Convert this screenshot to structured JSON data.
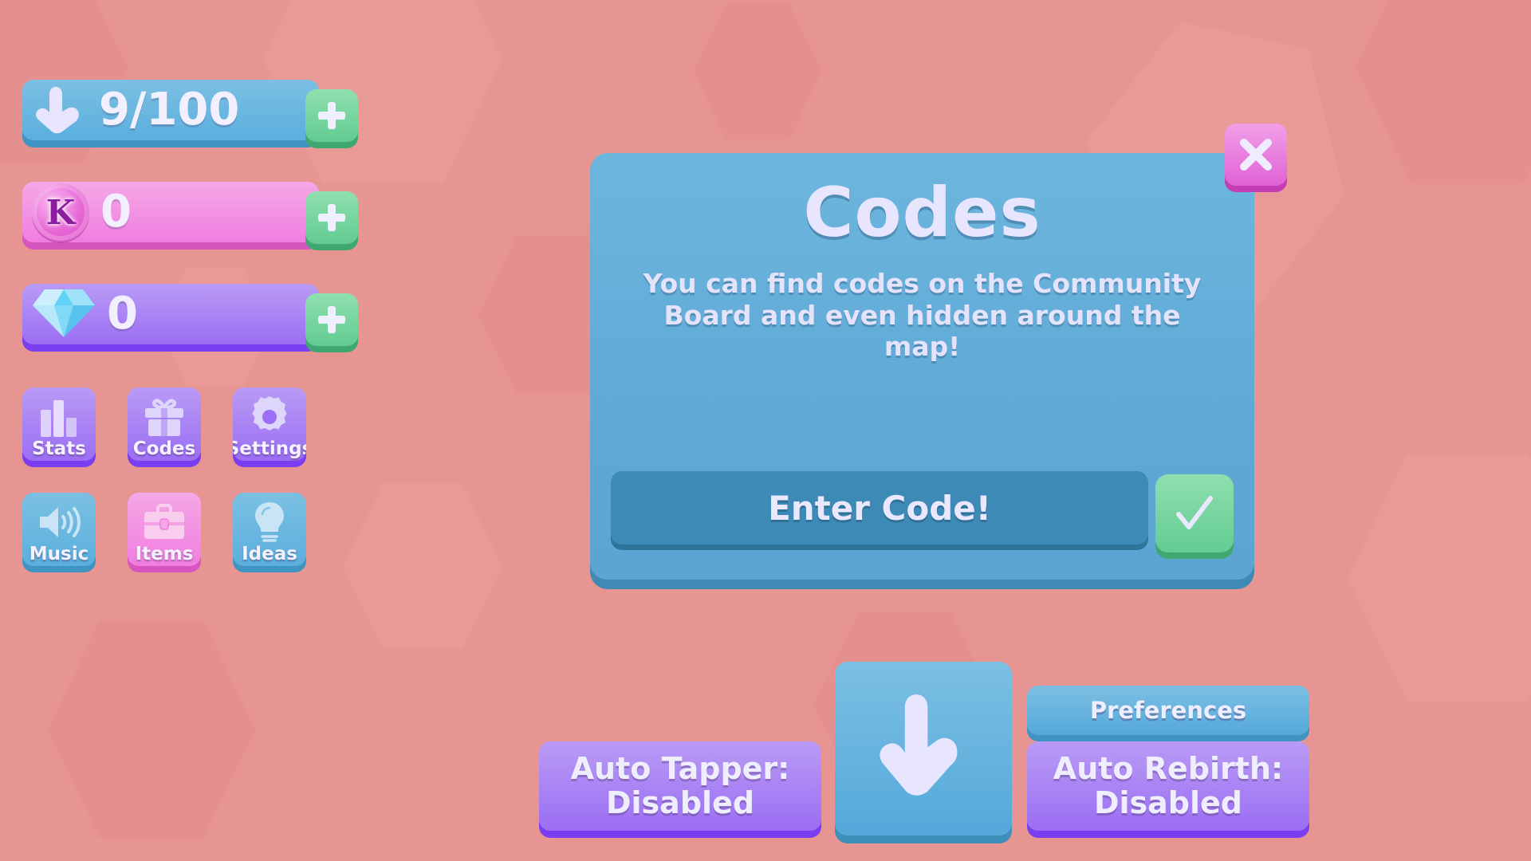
{
  "theme": {
    "background": "#e79592",
    "blue": "#5aafdd",
    "purple": "#9b6ef3",
    "pink": "#f07ee0",
    "green": "#63cb93",
    "dialog_blue": "#5fa9d6",
    "text_light": "#eceaff"
  },
  "hud": {
    "taps": {
      "icon": "hand-tap-icon",
      "value": "9/100",
      "add_label": "+"
    },
    "coins": {
      "icon": "k-coin-icon",
      "value": "0",
      "add_label": "+"
    },
    "gems": {
      "icon": "gem-icon",
      "value": "0",
      "add_label": "+"
    }
  },
  "menu_tiles": [
    {
      "id": "stats",
      "label": "Stats",
      "icon": "bar-chart-icon",
      "color": "purple"
    },
    {
      "id": "codes",
      "label": "Codes",
      "icon": "gift-icon",
      "color": "purple"
    },
    {
      "id": "settings",
      "label": "Settings",
      "icon": "gear-icon",
      "color": "purple"
    },
    {
      "id": "music",
      "label": "Music",
      "icon": "speaker-icon",
      "color": "blue"
    },
    {
      "id": "items",
      "label": "Items",
      "icon": "briefcase-icon",
      "color": "pink"
    },
    {
      "id": "ideas",
      "label": "Ideas",
      "icon": "lightbulb-icon",
      "color": "blue"
    }
  ],
  "dialog": {
    "title": "Codes",
    "description": "You can find codes on the Community Board and even hidden around the map!",
    "input_placeholder": "Enter Code!",
    "input_value": "",
    "submit_icon": "checkmark-icon",
    "close_icon": "close-x-icon"
  },
  "bottom_bar": {
    "auto_tapper": {
      "label": "Auto Tapper:\nDisabled",
      "state": "Disabled"
    },
    "auto_rebirth": {
      "label": "Auto Rebirth:\nDisabled",
      "state": "Disabled"
    },
    "preferences": {
      "label": "Preferences"
    },
    "tap": {
      "icon": "hand-tap-icon"
    }
  }
}
